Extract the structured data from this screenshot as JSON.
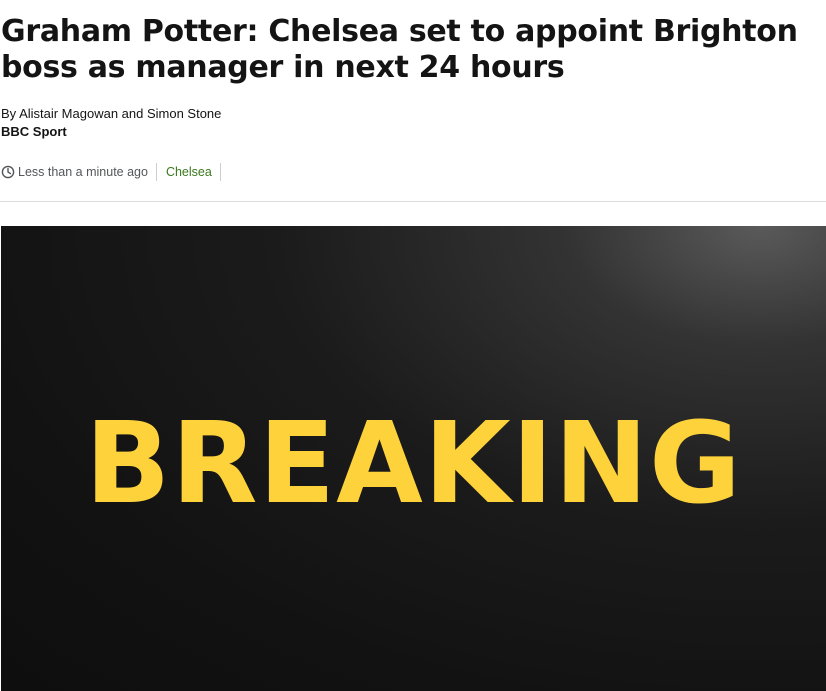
{
  "article": {
    "headline": "Graham Potter: Chelsea set to appoint Brighton boss as manager in next 24 hours",
    "byline": {
      "authors": "By Alistair Magowan and Simon Stone",
      "source": "BBC Sport"
    },
    "meta": {
      "timestamp": "Less than a minute ago",
      "topic": "Chelsea",
      "icon": "clock-icon"
    },
    "hero_image": {
      "text": "BREAKING"
    }
  },
  "colors": {
    "topic_link": "#3a7a1d",
    "breaking_yellow": "#fdd23a",
    "hero_background": "#141414"
  }
}
